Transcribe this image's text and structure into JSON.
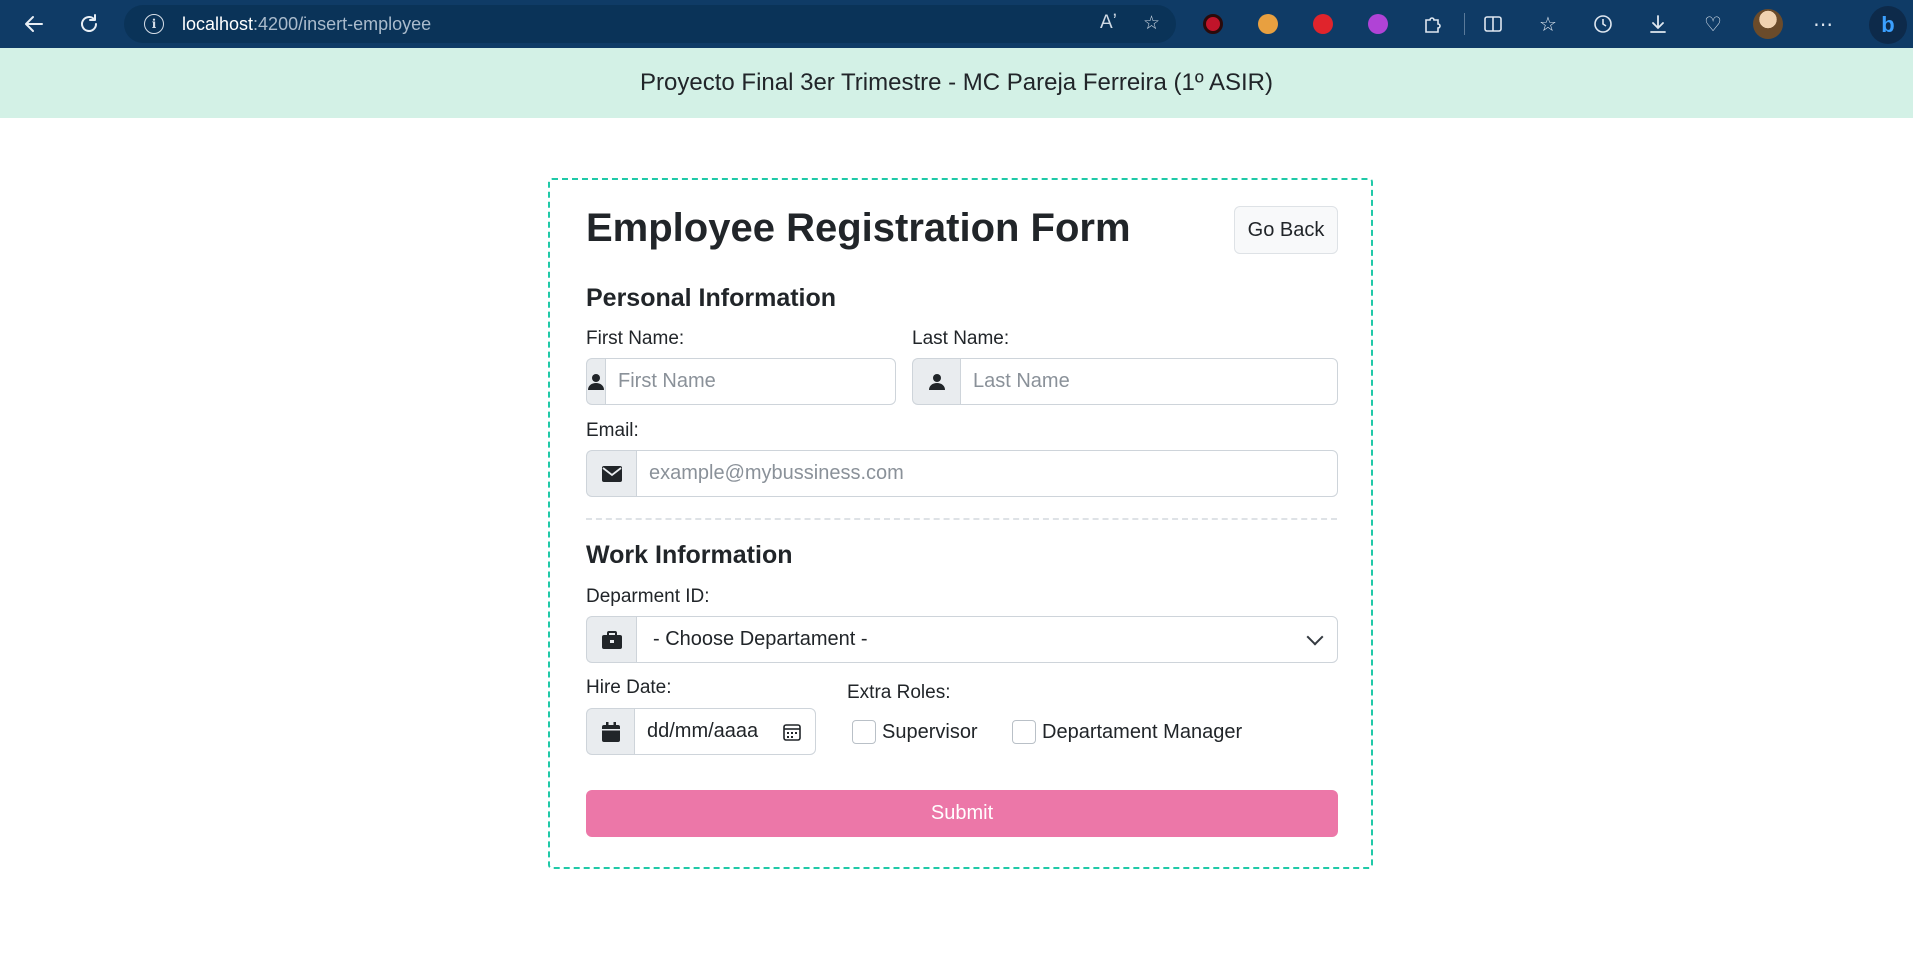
{
  "browser": {
    "url_host": "localhost",
    "url_path": ":4200/insert-employee",
    "icons": [
      "back-icon",
      "reload-icon",
      "info-icon",
      "read-aloud-icon",
      "favorite-star-icon",
      "extension-icons",
      "split-screen-icon",
      "favorites-icon",
      "history-icon",
      "downloads-icon",
      "health-icon",
      "profile-avatar",
      "more-icon",
      "bing-icon"
    ],
    "read_aloud_glyph": "Aʼ",
    "bing_glyph": "b"
  },
  "app_header": {
    "title": "Proyecto Final 3er Trimestre - MC Pareja Ferreira (1º ASIR)"
  },
  "form": {
    "title": "Employee Registration Form",
    "go_back_label": "Go Back",
    "personal_section": "Personal Information",
    "first_name_label": "First Name:",
    "first_name_placeholder": "First Name",
    "last_name_label": "Last Name:",
    "last_name_placeholder": "Last Name",
    "email_label": "Email:",
    "email_placeholder": "example@mybussiness.com",
    "work_section": "Work Information",
    "department_label": "Deparment ID:",
    "department_selected": "- Choose Departament -",
    "hire_date_label": "Hire Date:",
    "hire_date_value": "dd/mm/aaaa",
    "extra_roles_label": "Extra Roles:",
    "roles": [
      "Supervisor",
      "Departament Manager"
    ],
    "submit_label": "Submit"
  },
  "colors": {
    "browser_bar": "#0f3b66",
    "header_bg": "#d3f1e6",
    "card_border": "#20c9a8",
    "submit_bg": "#ec77a8"
  }
}
